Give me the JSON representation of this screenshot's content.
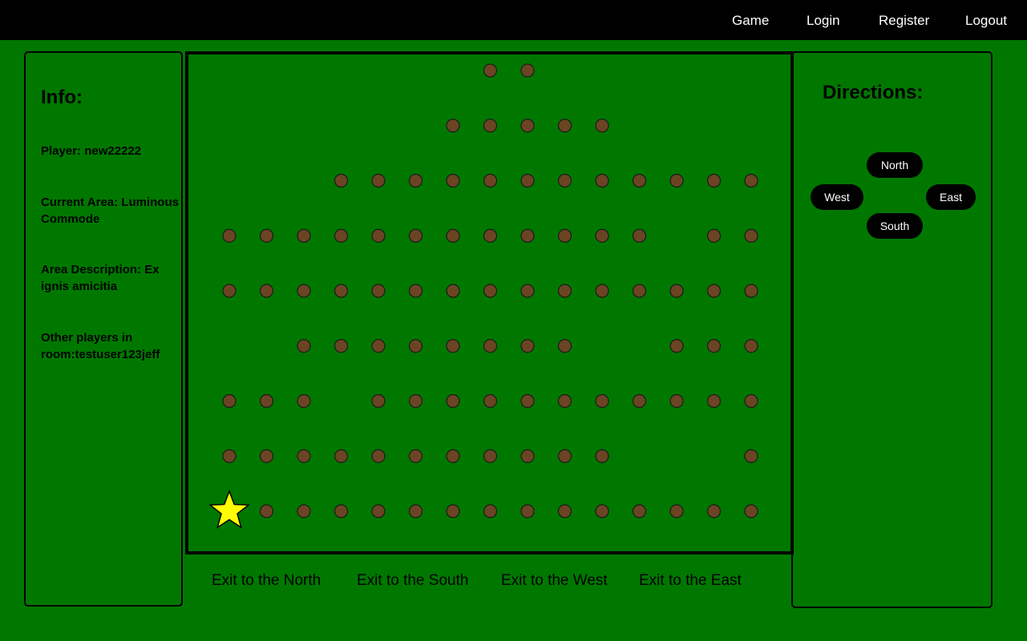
{
  "nav": {
    "game": "Game",
    "login": "Login",
    "register": "Register",
    "logout": "Logout"
  },
  "info": {
    "title": "Info:",
    "player": "Player: new22222",
    "current_area": "Current Area: Luminous Commode",
    "area_description": "Area Description: Ex ignis amicitia",
    "other_players": "Other players in room:testuser123jeff"
  },
  "map": {
    "grid_rows": [
      "_____________..__________________",
      "_____________.....___________________",
      "______..........................",
      "............._..",
      "...............",
      "__.......__...",
      "...__..........",
      "...........___.",
      "*.............."
    ],
    "columns": 15,
    "rows": 9,
    "player_position": {
      "row": 9,
      "col": 1
    },
    "dot_color": "#6b4423",
    "board_color": "#007800",
    "star_color": "#ffff00"
  },
  "exits": {
    "north": "Exit to the North",
    "south": "Exit to the South",
    "west": "Exit to the West",
    "east": "Exit to the East"
  },
  "directions": {
    "title": "Directions:",
    "north": "North",
    "west": "West",
    "east": "East",
    "south": "South"
  }
}
